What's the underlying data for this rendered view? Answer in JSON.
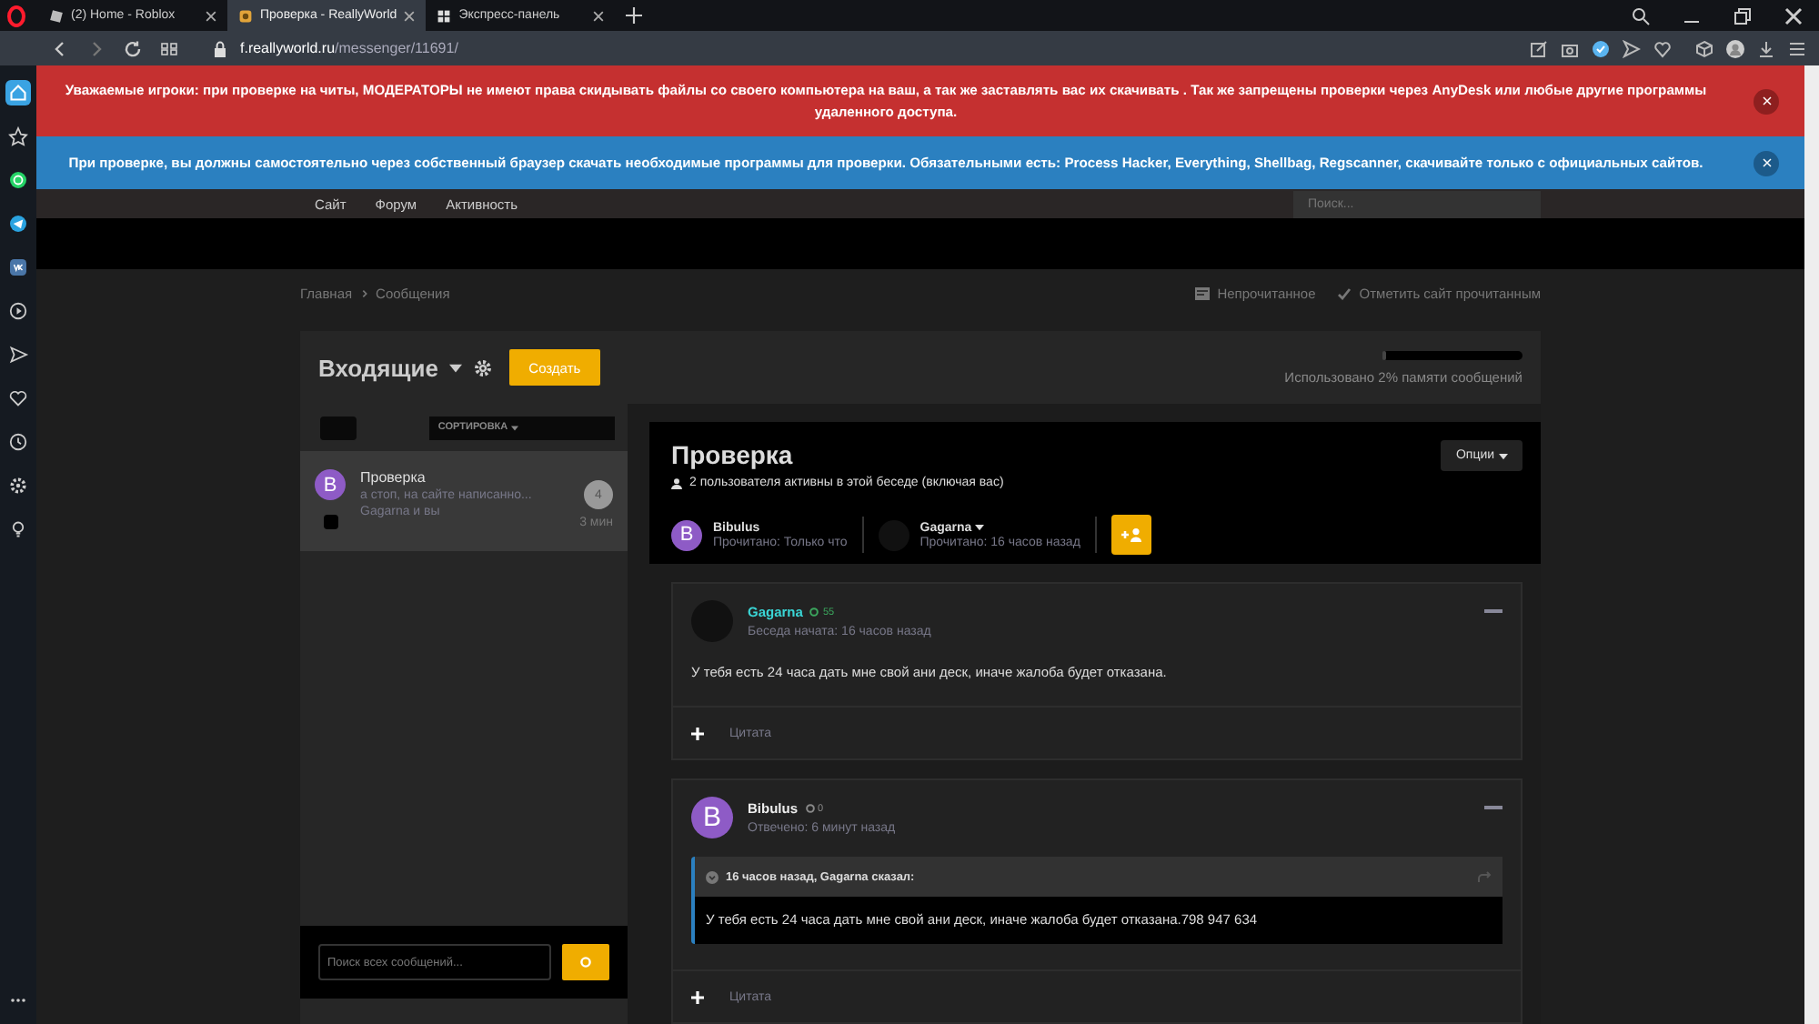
{
  "browser": {
    "tabs": [
      {
        "title": "(2) Home - Roblox",
        "kind": "roblox",
        "selected": false
      },
      {
        "title": "Проверка - ReallyWorld",
        "kind": "site",
        "selected": true
      },
      {
        "title": "Экспресс-панель",
        "kind": "grid",
        "selected": false
      }
    ],
    "url_host": "f.reallyworld.ru",
    "url_path": "/messenger/11691/",
    "sidebar": [
      {
        "kind": "home",
        "selected": true
      },
      {
        "kind": "star",
        "selected": false
      },
      {
        "kind": "whatsapp",
        "selected": false
      },
      {
        "kind": "telegram",
        "selected": false
      },
      {
        "kind": "vk",
        "selected": false
      },
      {
        "kind": "play",
        "selected": false
      },
      {
        "kind": "send",
        "selected": false
      },
      {
        "kind": "heart",
        "selected": false
      },
      {
        "kind": "clock",
        "selected": false
      },
      {
        "kind": "gear",
        "selected": false
      },
      {
        "kind": "bulb",
        "selected": false
      },
      {
        "kind": "more",
        "selected": false
      }
    ]
  },
  "notices": [
    {
      "kind": "danger",
      "text": "Уважаемые игроки: при проверке на читы, МОДЕРАТОРЫ не имеют права скидывать файлы со своего компьютера на ваш, а так же заставлять вас их скачивать . Так же запрещены проверки через AnyDesk или любые другие программы удаленного доступа."
    },
    {
      "kind": "info",
      "text": "При проверке, вы должны самостоятельно через собственный браузер скачать необходимые программы для проверки. Обязательными есть: Process Hacker, Everything, Shellbag, Regscanner, скачивайте только с официальных сайтов."
    }
  ],
  "nav": {
    "items": [
      "Сайт",
      "Форум",
      "Активность"
    ],
    "search_placeholder": "Поиск..."
  },
  "breadcrumb": [
    "Главная",
    "Сообщения"
  ],
  "page_actions": [
    {
      "kind": "unread",
      "label": "Непрочитанное"
    },
    {
      "kind": "mark",
      "label": "Отметить сайт прочитанным"
    }
  ],
  "inbox": {
    "title": "Входящие",
    "create_button": "Создать",
    "storage": {
      "level": 0.02,
      "text": "Использовано 2% памяти сообщений"
    },
    "sort_label": "СОРТИРОВКА",
    "conversations": [
      {
        "title": "Проверка",
        "preview": "а стоп, на сайте написанно...",
        "participants": "Gagarna и вы",
        "count": "4",
        "time": "3 мин",
        "avatar": "B",
        "selected": true,
        "checked": false
      }
    ],
    "search_placeholder": "Поиск всех сообщений..."
  },
  "conversation": {
    "title": "Проверка",
    "active_info": "2 пользователя активны в этой беседе (включая вас)",
    "options_button": "Опции",
    "participants": [
      {
        "name": "Bibulus",
        "status": "Прочитано: Только что",
        "avatar": "B",
        "menu": false
      },
      {
        "name": "Gagarna",
        "status": "Прочитано: 16 часов назад",
        "menu": true
      }
    ],
    "messages": [
      {
        "author": "Gagarna",
        "highlighted": true,
        "points": "55",
        "meta": "Беседа начата: 16 часов назад",
        "body": "У тебя есть 24 часа дать мне свой ани деск, иначе жалоба будет отказана.",
        "action": "Цитата"
      },
      {
        "author": "Bibulus",
        "highlighted": false,
        "avatar": "B",
        "points": "0",
        "meta": "Отвечено: 6 минут назад",
        "quote": {
          "header": "16 часов назад, Gagarna сказал:",
          "body": "У тебя есть 24 часа дать мне свой ани деск, иначе жалоба будет отказана.798 947 634"
        },
        "action": "Цитата"
      }
    ]
  }
}
